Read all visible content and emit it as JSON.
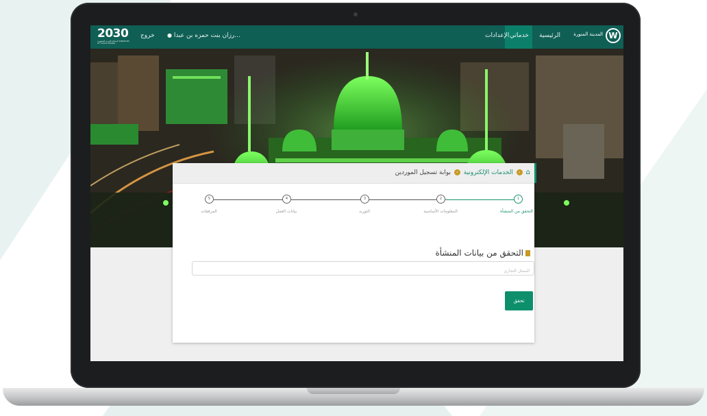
{
  "topbar": {
    "vision_logo": "2030",
    "vision_subtitle": "المملكة العربية السعودية KINGDOM OF SAUDI ARABIA",
    "logout_label": "خروج",
    "user_name": "رزان بنت حمزه بن عبدا...",
    "nav": [
      "الرئيسية",
      "خدماتي",
      "الإعدادات"
    ],
    "active_nav": "خدماتي",
    "brand_text": "المدينة المنورة"
  },
  "breadcrumb": {
    "home_icon": "home-icon",
    "items": [
      "الخدمات الإلكترونية",
      "بوابة تسجيل الموردين"
    ]
  },
  "steps": [
    {
      "number": "1",
      "label": "التحقق من المنشأة",
      "active": true
    },
    {
      "number": "2",
      "label": "المعلومات الأساسية",
      "active": false
    },
    {
      "number": "3",
      "label": "التوريد",
      "active": false
    },
    {
      "number": "4",
      "label": "بيانات العمل",
      "active": false
    },
    {
      "number": "5",
      "label": "المرفقات",
      "active": false
    }
  ],
  "form": {
    "section_title": "التحقق من بيانات المنشأة",
    "cr_placeholder": "السجل التجاري",
    "cr_value": "",
    "verify_button": "تحقق"
  },
  "colors": {
    "primary": "#0f5f55",
    "accent": "#0e8f6c",
    "gold": "#c79a26"
  }
}
